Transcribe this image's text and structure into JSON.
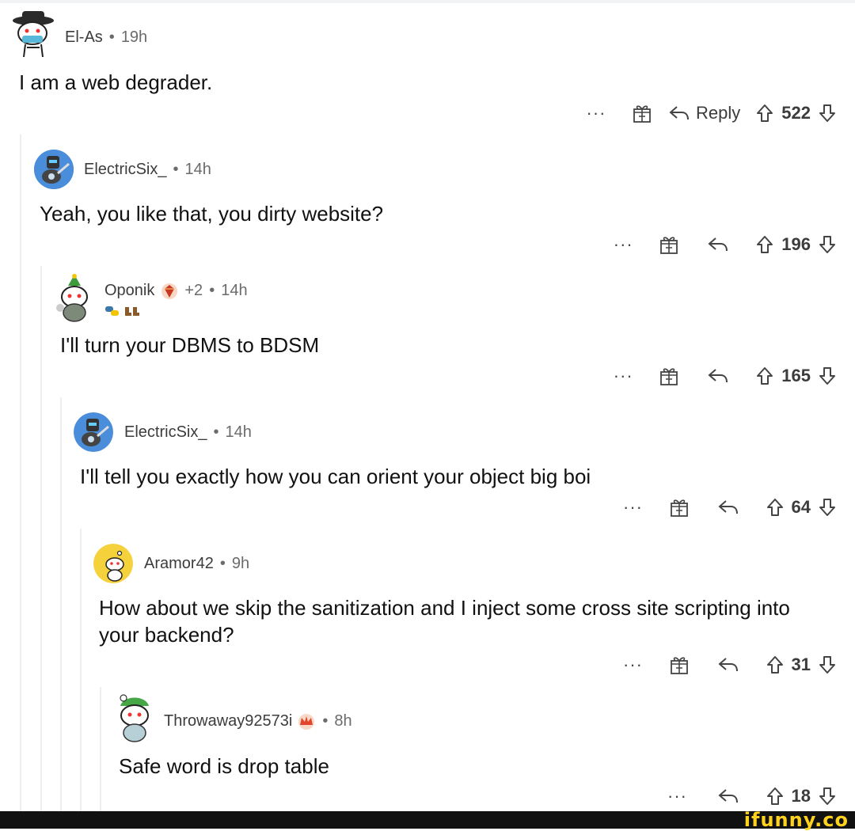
{
  "comments": [
    {
      "user": "El-As",
      "time": "19h",
      "text": "I am a web degrader.",
      "reply_label": "Reply",
      "votes": "522"
    },
    {
      "user": "ElectricSix_",
      "time": "14h",
      "text": "Yeah, you like that, you dirty website?",
      "votes": "196"
    },
    {
      "user": "Oponik",
      "karma": "+2",
      "time": "14h",
      "text": "I'll turn your DBMS to BDSM",
      "votes": "165"
    },
    {
      "user": "ElectricSix_",
      "time": "14h",
      "text": "I'll tell you exactly how you can orient your object big boi",
      "votes": "64"
    },
    {
      "user": "Aramor42",
      "time": "9h",
      "text": "How about we skip the sanitization and I inject some cross site scripting into your backend?",
      "votes": "31"
    },
    {
      "user": "Throwaway92573i",
      "time": "8h",
      "text": "Safe word is drop table",
      "votes": "18"
    }
  ],
  "icons": {
    "more": "more-icon",
    "gift": "gift-icon",
    "reply": "reply-icon",
    "upvote": "upvote-icon",
    "downvote": "downvote-icon"
  },
  "watermark": "ifunny.co",
  "colors": {
    "text": "#1c1c1c",
    "meta": "#6b6b6b",
    "thread_line": "#eceef0",
    "watermark": "#ffd21e"
  }
}
